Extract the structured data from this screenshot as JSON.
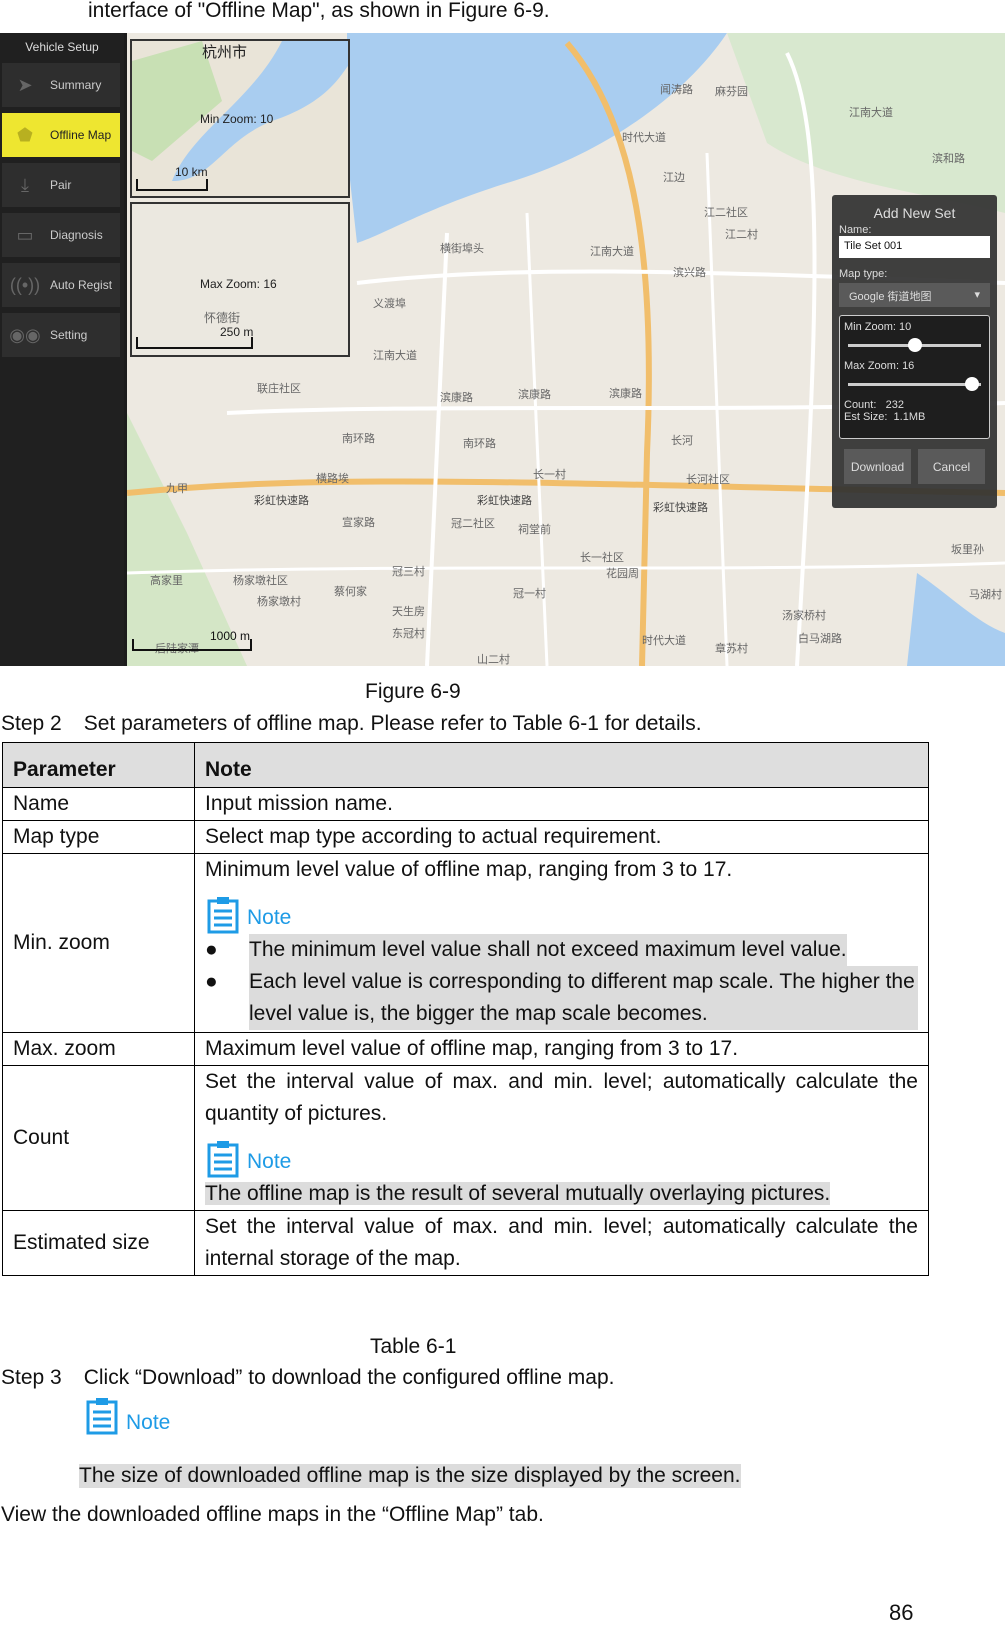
{
  "intro_line": "interface of \"Offline Map\", as shown in Figure 6-9.",
  "screenshot": {
    "sidebar": {
      "title": "Vehicle Setup",
      "items": [
        {
          "label": "Summary",
          "icon": "paper-plane-icon"
        },
        {
          "label": "Offline Map",
          "icon": "map-icon",
          "active": true
        },
        {
          "label": "Pair",
          "icon": "download-tray-icon"
        },
        {
          "label": "Diagnosis",
          "icon": "battery-pulse-icon"
        },
        {
          "label": "Auto Regist",
          "icon": "broadcast-icon"
        },
        {
          "label": "Setting",
          "icon": "gear-icon"
        }
      ]
    },
    "inset_min": {
      "city": "杭州市",
      "label": "Min Zoom: 10",
      "scale": "10 km"
    },
    "inset_max": {
      "label": "Max Zoom: 16",
      "street": "怀德街",
      "scale": "250 m"
    },
    "map_labels": [
      "江边",
      "江二社区",
      "江二村",
      "滨兴路",
      "江南大道",
      "横街埠头",
      "义渡埠",
      "江南大道",
      "联庄社区",
      "滨康路",
      "滨康路",
      "滨康路",
      "长河",
      "南环路",
      "南环路",
      "长一村",
      "长河社区",
      "横路埃",
      "彩虹快速路",
      "彩虹快速路",
      "彩虹快速路",
      "宣家路",
      "冠二社区",
      "祠堂前",
      "长一社区",
      "花园周",
      "冠三村",
      "冠一村",
      "杨家墩社区",
      "杨家墩村",
      "高家里",
      "蔡何家",
      "天生房",
      "东冠村",
      "章苏村",
      "汤家桥村",
      "白马湖路",
      "江南大道",
      "时代大道",
      "时代大道",
      "闻涛路",
      "滨和路",
      "马湖村",
      "坂里孙",
      "九甲",
      "后陆家潭",
      "山二村",
      "麻芬园"
    ],
    "map_scale": "1000 m",
    "dialog": {
      "title": "Add New Set",
      "name_label": "Name:",
      "name_value": "Tile Set 001",
      "map_type_label": "Map type:",
      "map_type_value": "Google 街道地图",
      "min_zoom_label": "Min Zoom: 10",
      "min_zoom": 10,
      "max_zoom_label": "Max Zoom: 16",
      "max_zoom": 16,
      "zoom_range": [
        3,
        17
      ],
      "count_label": "Count:",
      "count": "232",
      "size_label": "Est Size:",
      "size": "1.1MB",
      "download": "Download",
      "cancel": "Cancel"
    }
  },
  "figure_caption": "Figure 6-9",
  "step2": {
    "num": "Step 2",
    "text": "Set parameters of offline map. Please refer to Table 6-1 for details."
  },
  "table": {
    "headers": [
      "Parameter",
      "Note"
    ],
    "rows": {
      "name": [
        "Name",
        "Input mission name."
      ],
      "maptype": [
        "Map type",
        "Select map type according to actual requirement."
      ],
      "minzoom": {
        "param": "Min. zoom",
        "text": "Minimum level value of offline map, ranging from 3 to 17.",
        "note": "Note",
        "bullets": [
          "The minimum level value shall not exceed maximum level value.",
          "Each level value is corresponding to different map scale. The higher the level value is, the bigger the map scale becomes."
        ]
      },
      "maxzoom": [
        "Max. zoom",
        "Maximum level value of offline map, ranging from 3 to 17."
      ],
      "count": {
        "param": "Count",
        "text": "Set the interval value of max. and min. level; automatically calculate the quantity of pictures.",
        "note": "Note",
        "note_text": "The offline map is the result of several mutually overlaying pictures."
      },
      "size": [
        "Estimated size",
        "Set the interval value of max. and min. level; automatically calculate the internal storage of the map."
      ]
    }
  },
  "table_caption": "Table 6-1",
  "step3": {
    "num": "Step 3",
    "text": "Click “Download” to download the configured offline map.",
    "note": "Note",
    "note_text": "The size of downloaded offline map is the size displayed by the screen."
  },
  "final_line": "View the downloaded offline maps in the “Offline Map” tab.",
  "page_number": "86",
  "colors": {
    "note_blue": "#1e9be6",
    "active_tab": "#eee630",
    "highlight": "#dcdcdc"
  }
}
